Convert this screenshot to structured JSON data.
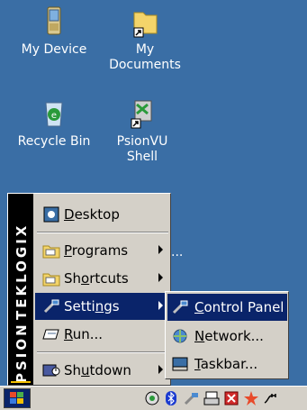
{
  "desktop": {
    "icons": [
      {
        "label": "My Device"
      },
      {
        "label": "My Documents"
      },
      {
        "label": "Recycle Bin"
      },
      {
        "label": "PsionVU Shell"
      }
    ],
    "partial_label": "..."
  },
  "start_menu": {
    "brand_top": "TEKLOGIX",
    "brand_bottom": "PSION",
    "items": [
      {
        "label": "Desktop",
        "accel": "D",
        "rest": "esktop"
      },
      {
        "label": "Programs",
        "accel": "P",
        "rest": "rograms"
      },
      {
        "label": "Shortcuts",
        "pre": "Sh",
        "accel": "o",
        "rest": "rtcuts"
      },
      {
        "label": "Settings",
        "pre": "Setti",
        "accel": "n",
        "rest": "gs"
      },
      {
        "label": "Run...",
        "accel": "R",
        "rest": "un..."
      },
      {
        "label": "Shutdown",
        "pre": "Sh",
        "accel": "u",
        "rest": "tdown"
      }
    ]
  },
  "settings_submenu": {
    "items": [
      {
        "accel": "C",
        "rest": "ontrol Panel"
      },
      {
        "accel": "N",
        "rest": "etwork..."
      },
      {
        "accel": "T",
        "rest": "askbar..."
      }
    ]
  },
  "colors": {
    "desktop_bg": "#3a6ea5",
    "menu_bg": "#d4d0c8",
    "selection_bg": "#0a246a"
  }
}
